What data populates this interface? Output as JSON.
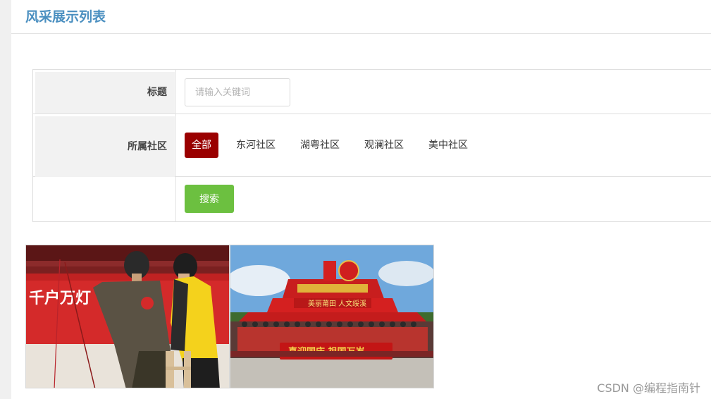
{
  "page": {
    "title": "风采展示列表"
  },
  "filters": {
    "title_label": "标题",
    "title_placeholder": "请输入关键词",
    "community_label": "所属社区",
    "community_options": [
      {
        "label": "全部",
        "active": true
      },
      {
        "label": "东河社区",
        "active": false
      },
      {
        "label": "湖粤社区",
        "active": false
      },
      {
        "label": "观澜社区",
        "active": false
      },
      {
        "label": "美中社区",
        "active": false
      }
    ],
    "search_button": "搜索"
  },
  "gallery": {
    "items": [
      {
        "name": "lantern-installation-photo",
        "banner_text": "千户万灯"
      },
      {
        "name": "community-group-photo",
        "arch_text": "美丽莆田 人文绥溪",
        "banner_text": "喜迎国庆 祖国万岁"
      }
    ]
  },
  "watermark": "CSDN @编程指南针",
  "colors": {
    "title": "#4a8fc0",
    "active_tab": "#9a0000",
    "search_button": "#6cc040"
  }
}
